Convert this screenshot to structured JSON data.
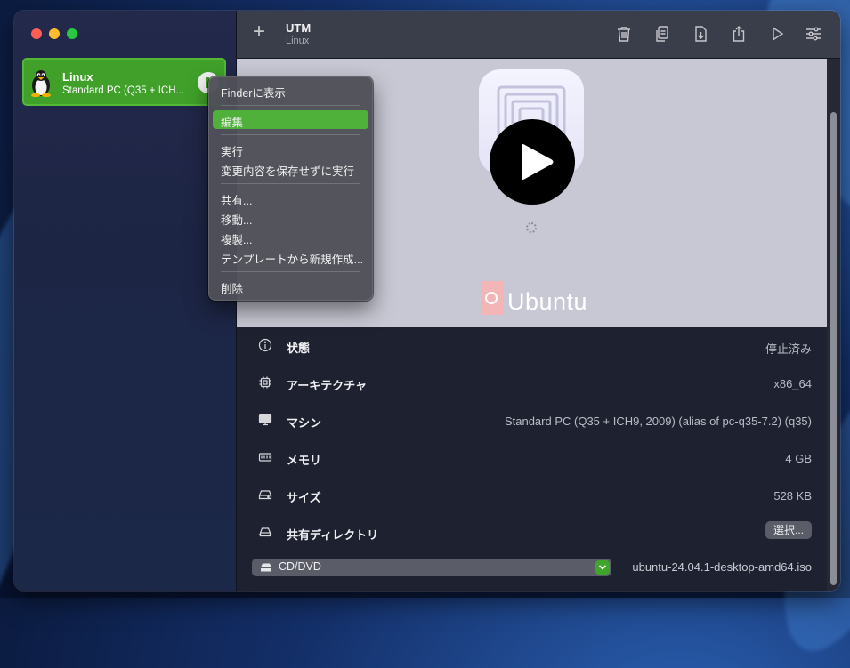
{
  "toolbar": {
    "title": "UTM",
    "subtitle": "Linux",
    "add_symbol": "+"
  },
  "vm": {
    "name": "Linux",
    "subtitle": "Standard PC (Q35 + ICH..."
  },
  "preview": {
    "os_label": "Ubuntu"
  },
  "info_rows": [
    {
      "label": "状態",
      "value": "停止済み",
      "icon": "info-icon"
    },
    {
      "label": "アーキテクチャ",
      "value": "x86_64",
      "icon": "cpu-icon"
    },
    {
      "label": "マシン",
      "value": "Standard PC (Q35 + ICH9, 2009) (alias of pc-q35-7.2) (q35)",
      "icon": "display-icon"
    },
    {
      "label": "メモリ",
      "value": "4 GB",
      "icon": "memory-icon"
    },
    {
      "label": "サイズ",
      "value": "528 KB",
      "icon": "drive-icon"
    },
    {
      "label": "共有ディレクトリ",
      "value": "",
      "icon": "shared-drive-icon"
    }
  ],
  "shared_dir_button": "選択...",
  "cd_dvd": {
    "label": "CD/DVD",
    "iso": "ubuntu-24.04.1-desktop-amd64.iso"
  },
  "context_menu": {
    "items": [
      "Finderに表示",
      "編集",
      "実行",
      "変更内容を保存せずに実行",
      "共有...",
      "移動...",
      "複製...",
      "テンプレートから新規作成...",
      "削除"
    ],
    "highlighted": "編集"
  },
  "colors": {
    "accent": "#40a02a",
    "highlight": "#4fb03a",
    "toolbar": "#3a3d4a",
    "info_bg": "#1e2230"
  }
}
